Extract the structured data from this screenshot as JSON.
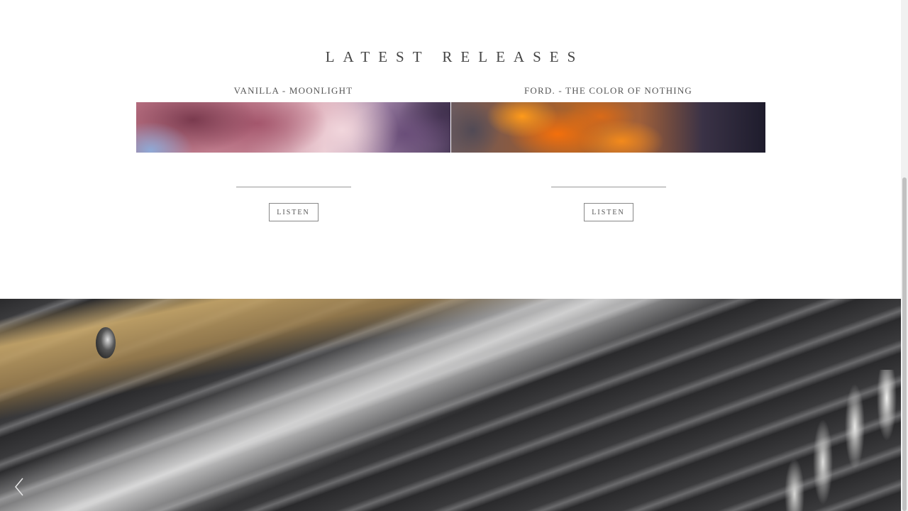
{
  "releases_section": {
    "title": "LATEST RELEASES",
    "items": [
      {
        "title": "VANILLA - MOONLIGHT",
        "art": "pink-purple-clouds-image",
        "button_label": "LISTEN"
      },
      {
        "title": "FORD. - THE COLOR OF NOTHING",
        "art": "orange-sunset-clouds-image",
        "button_label": "LISTEN"
      }
    ]
  },
  "hero": {
    "image": "piano-keys-photo",
    "prev_icon": "chevron-left-icon"
  },
  "colors": {
    "background": "#ffffff",
    "text": "#444444",
    "button_border": "#888888"
  }
}
